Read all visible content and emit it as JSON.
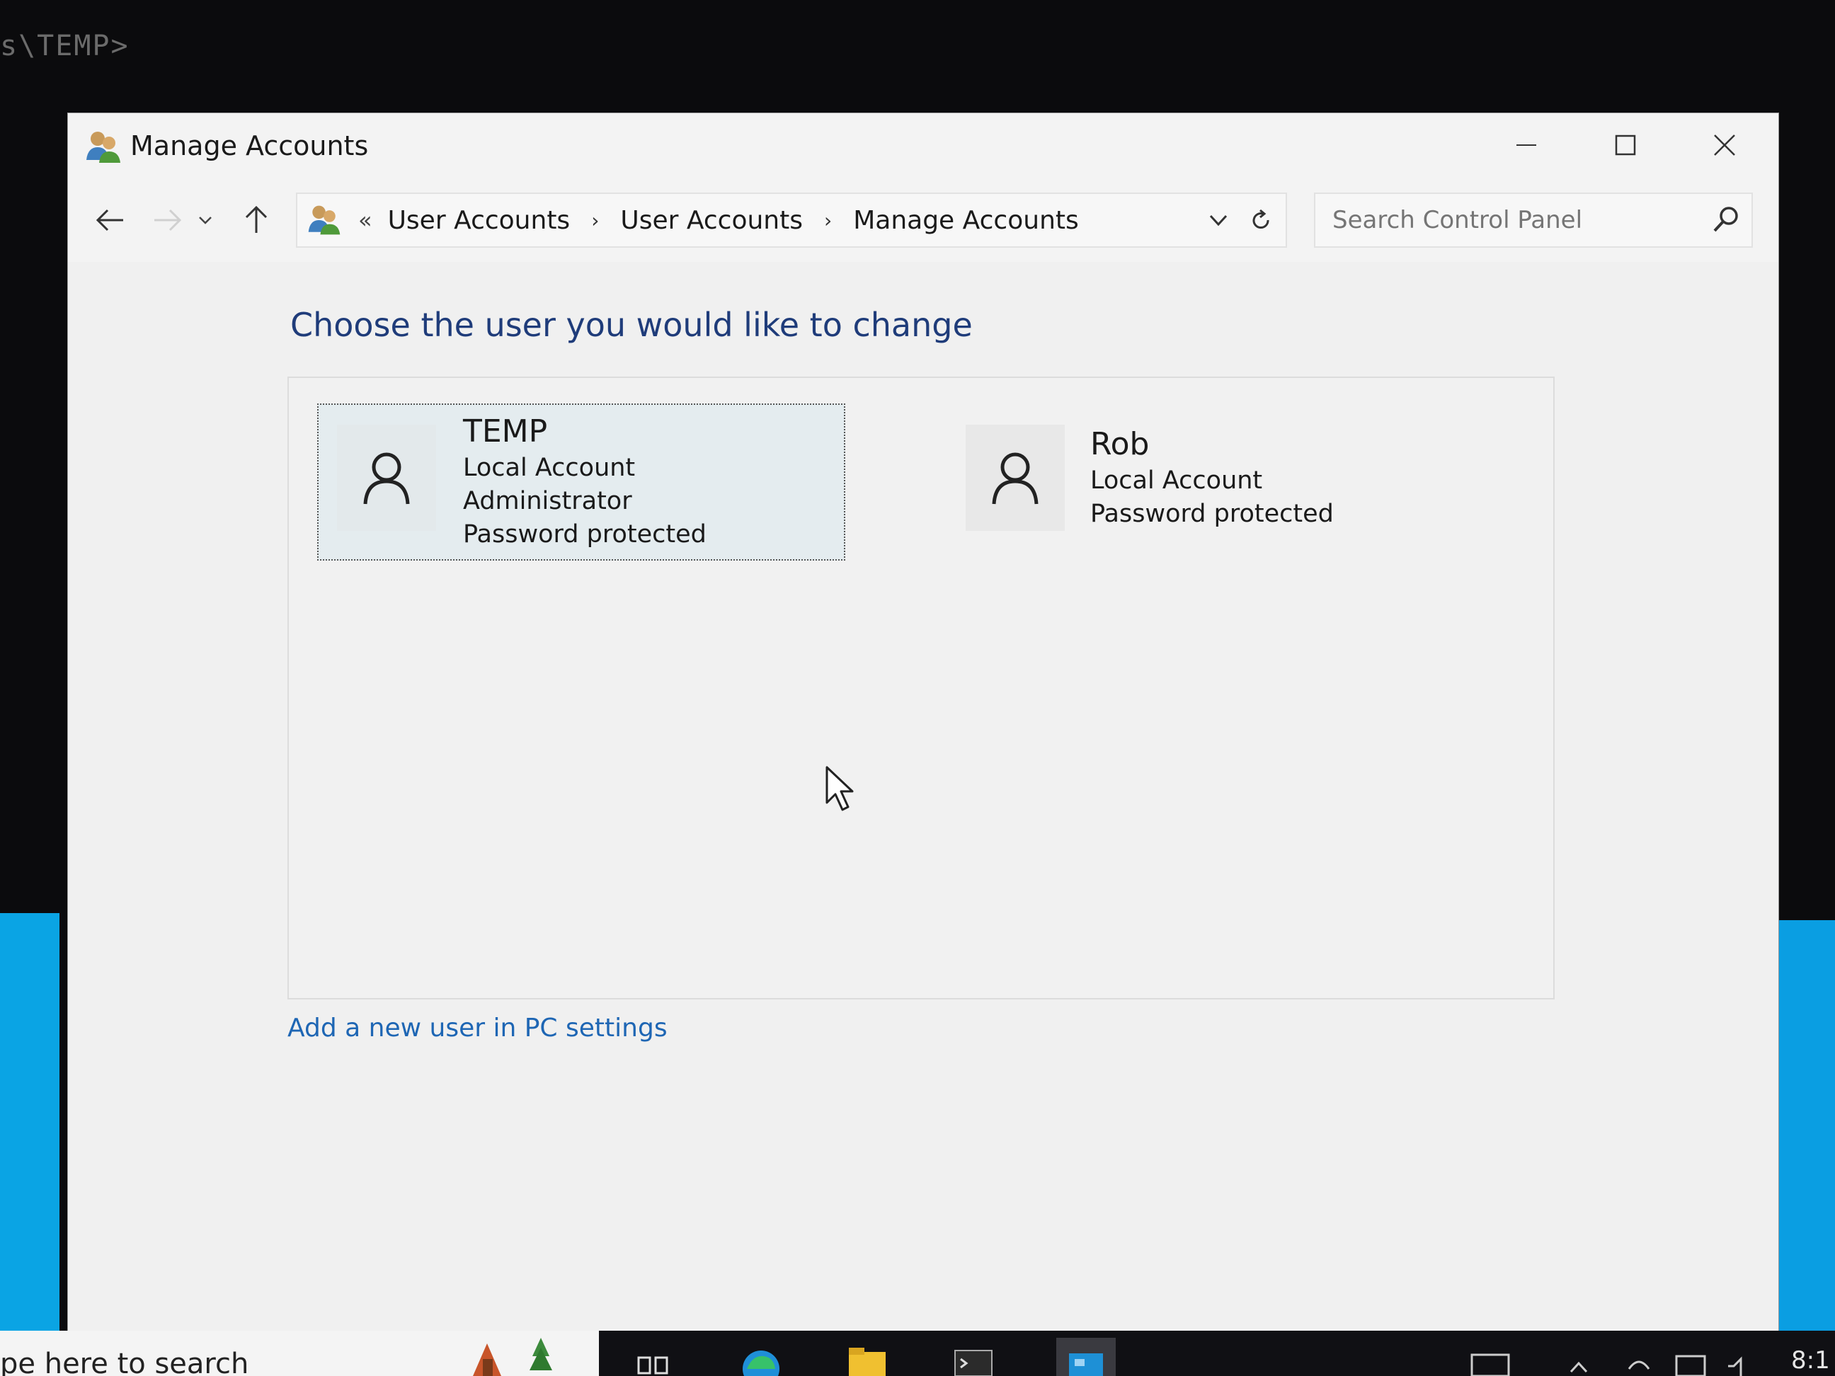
{
  "console": {
    "prompt_text": "s\\TEMP>"
  },
  "window": {
    "title": "Manage Accounts",
    "controls": {
      "minimize": "—",
      "maximize": "☐",
      "close": "✕"
    }
  },
  "navigation": {
    "back_icon": "arrow-left-icon",
    "forward_icon": "arrow-right-icon",
    "recent_icon": "chevron-down-icon",
    "up_icon": "arrow-up-icon",
    "breadcrumb": {
      "overflow": "«",
      "items": [
        "User Accounts",
        "User Accounts",
        "Manage Accounts"
      ],
      "separator": "›"
    },
    "search": {
      "placeholder": "Search Control Panel"
    }
  },
  "main": {
    "heading": "Choose the user you would like to change",
    "accounts": [
      {
        "name": "TEMP",
        "details": [
          "Local Account",
          "Administrator",
          "Password protected"
        ],
        "selected": true
      },
      {
        "name": "Rob",
        "details": [
          "Local Account",
          "Password protected"
        ],
        "selected": false
      }
    ],
    "add_user_link": "Add a new user in PC settings"
  },
  "taskbar": {
    "search_text": "pe here to search",
    "clock": "8:1",
    "icons": [
      "task-view-icon",
      "edge-icon",
      "file-explorer-icon",
      "terminal-icon",
      "control-panel-icon",
      "keyboard-icon",
      "chevron-up-icon",
      "network-icon",
      "display-icon",
      "volume-icon"
    ]
  },
  "colors": {
    "heading": "#1f3c7a",
    "link": "#1e66b4",
    "selected_tile": "#e4ecef",
    "desktop_accent": "#0aa4e4"
  }
}
